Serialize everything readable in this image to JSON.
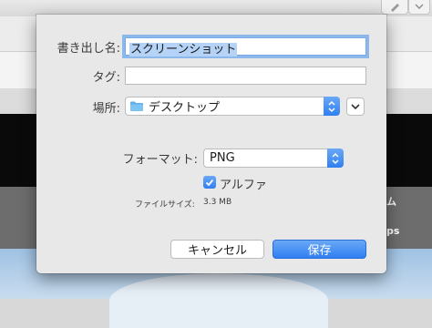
{
  "dialog": {
    "save_as": {
      "label": "書き出し名:",
      "value": "スクリーンショット"
    },
    "tags": {
      "label": "タグ:",
      "value": ""
    },
    "where": {
      "label": "場所:",
      "value": "デスクトップ"
    },
    "format": {
      "label": "フォーマット:",
      "value": "PNG"
    },
    "alpha": {
      "label": "アルファ",
      "checked": true
    },
    "file_size": {
      "label": "ファイルサイズ:",
      "value": "3.3 MB"
    },
    "buttons": {
      "cancel": "キャンセル",
      "save": "保存"
    }
  },
  "background": {
    "fragments": [
      "ム",
      "ps"
    ]
  },
  "colors": {
    "accent": "#2f7ff1",
    "focus_ring": "#8db8ec",
    "sheet_bg": "#e8e8e8"
  },
  "icons": {
    "folder": "folder-icon",
    "popup": "updown-chevron-icon",
    "expand": "chevron-down-icon",
    "check": "checkmark-icon",
    "toolbar": "pen-icon"
  }
}
